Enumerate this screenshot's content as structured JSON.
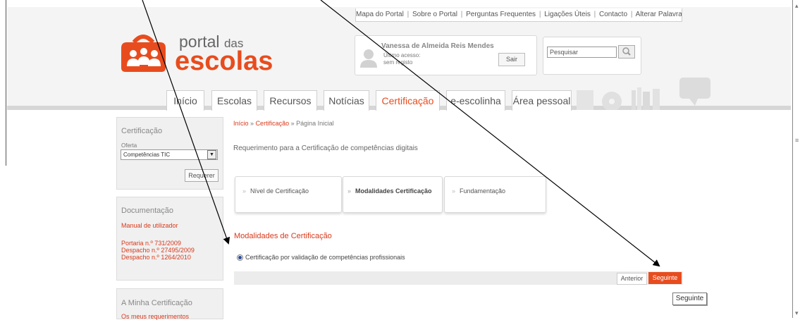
{
  "topnav": {
    "links": [
      "Mapa do Portal",
      "Sobre o Portal",
      "Perguntas Frequentes",
      "Ligações Úteis",
      "Contacto",
      "Alterar Palavra-chave"
    ],
    "separator": "|"
  },
  "logo": {
    "line1": "portal",
    "line1_small": "das",
    "line2": "escolas"
  },
  "user": {
    "name": "Vanessa de Almeida Reis Mendes",
    "last_access_label": "Último acesso:",
    "last_access_value": "sem registo",
    "logout_label": "Sair"
  },
  "search": {
    "value": "Pesquisar",
    "button_icon": "magnifier-icon"
  },
  "tabs": [
    {
      "label": "Início",
      "active": false
    },
    {
      "label": "Escolas",
      "active": false
    },
    {
      "label": "Recursos",
      "active": false
    },
    {
      "label": "Notícias",
      "active": false
    },
    {
      "label": "Certificação",
      "active": true
    },
    {
      "label": "e-escolinha",
      "active": false
    },
    {
      "label": "Área pessoal",
      "active": false
    }
  ],
  "sidebar": {
    "certificacao": {
      "title": "Certificação",
      "offer_label": "Oferta",
      "offer_value": "Competências TIC",
      "submit_label": "Requerer"
    },
    "documentacao": {
      "title": "Documentação",
      "links": [
        "Manual de utilizador",
        "Portaria n.º 731/2009",
        "Despacho n.º 27495/2009",
        "Despacho n.º 1264/2010"
      ]
    },
    "minha": {
      "title": "A Minha Certificação",
      "links": [
        "Os meus requerimentos"
      ]
    }
  },
  "content": {
    "breadcrumb": {
      "items": [
        "Início",
        "Certificação",
        "Página Inicial"
      ],
      "separator": "»"
    },
    "heading": "Requerimento para a Certificação de competências digitais",
    "steps": [
      {
        "label": "Nível de Certificação",
        "active": false
      },
      {
        "label": "Modalidades Certificação",
        "active": true
      },
      {
        "label": "Fundamentação",
        "active": false
      }
    ],
    "step_arrow": "»",
    "section_title": "Modalidades de Certificação",
    "option_label": "Certificação por validação de competências profissionais",
    "prev_label": "Anterior",
    "next_label": "Seguinte",
    "tooltip": "Seguinte"
  },
  "colors": {
    "accent": "#e84c1e",
    "link": "#d9391b",
    "header_bg": "#f4f4f4"
  }
}
